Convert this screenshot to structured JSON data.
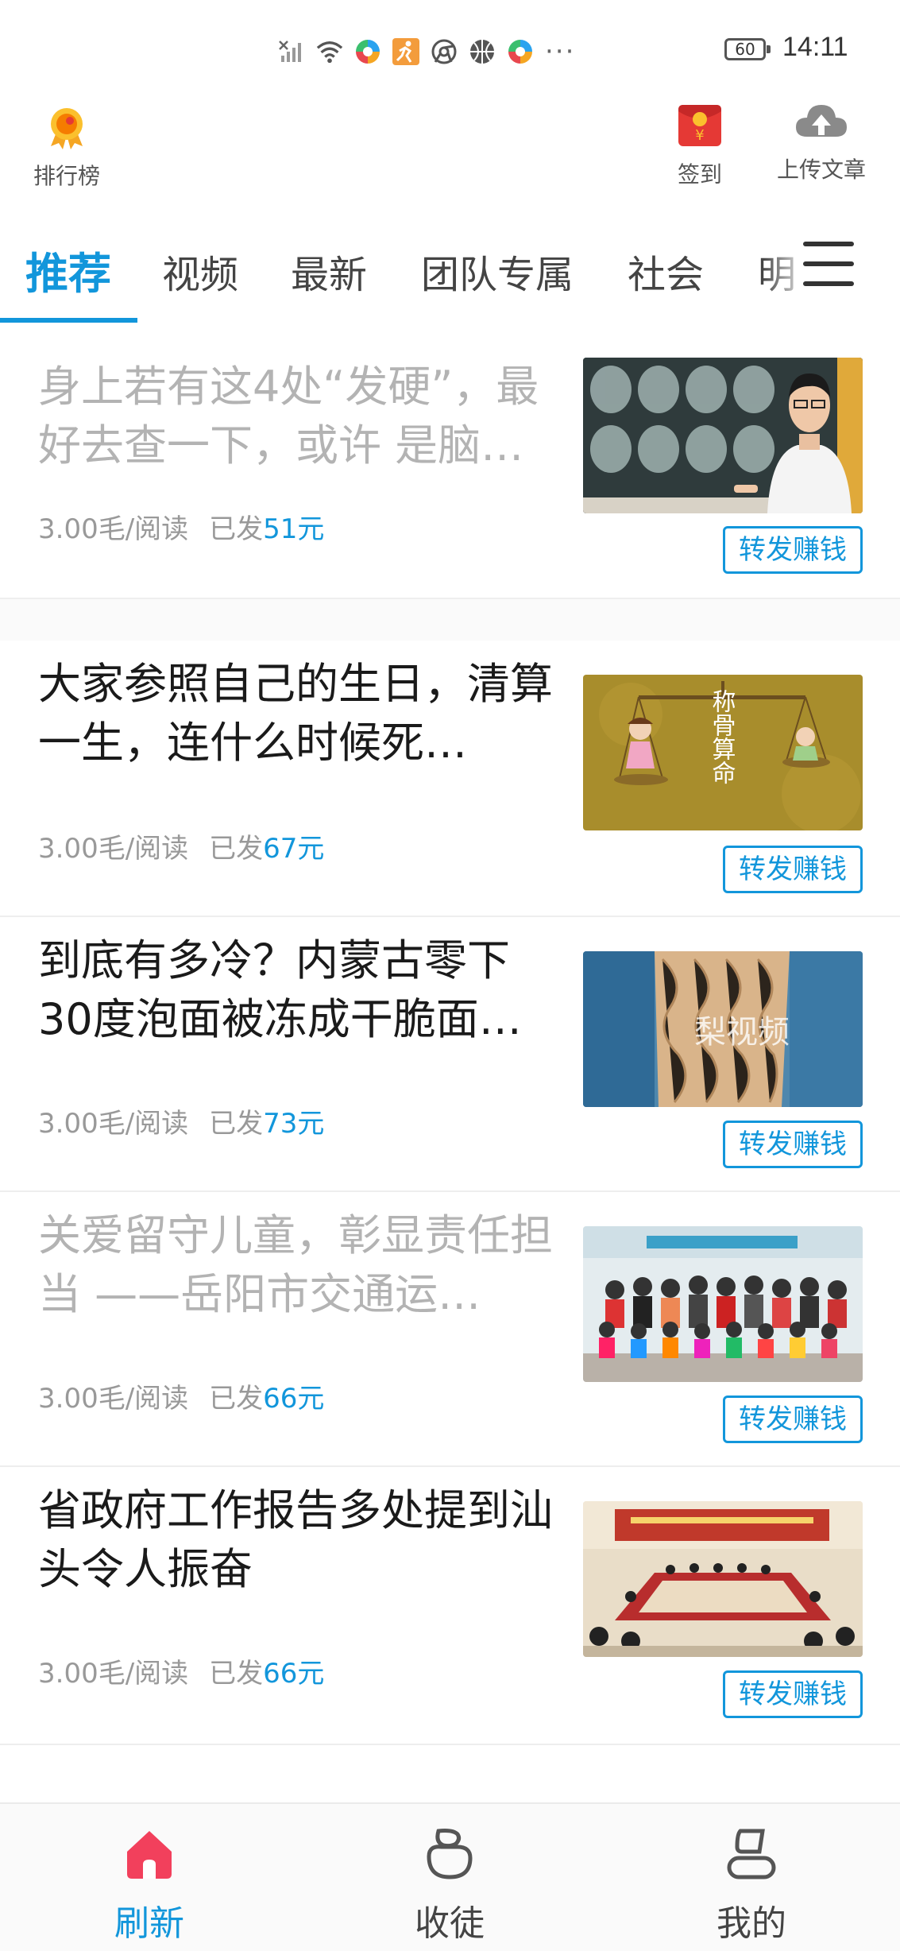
{
  "status_bar": {
    "time": "14:11",
    "battery": "60",
    "icons": [
      "no-sim-icon",
      "wifi-icon",
      "app-notification-icon",
      "fitness-icon",
      "chrome-icon",
      "basketball-icon",
      "app-notification-icon"
    ],
    "more": "···"
  },
  "header": {
    "rank_label": "排行榜",
    "signin_label": "签到",
    "upload_label": "上传文章"
  },
  "tabs": [
    {
      "label": "推荐",
      "active": true
    },
    {
      "label": "视频"
    },
    {
      "label": "最新"
    },
    {
      "label": "团队专属"
    },
    {
      "label": "社会"
    },
    {
      "label": "明"
    }
  ],
  "articles": [
    {
      "title": "身上若有这4处“发硬”，最好去查一下，或许 是脑…",
      "price": "3.00毛/阅读",
      "sent_prefix": "已发",
      "amount": "51元",
      "button": "转发赚钱",
      "read": true,
      "thumb": "brain-scan-doctor"
    },
    {
      "title": "大家参照自己的生日，清算一生，连什么时候死…",
      "price": "3.00毛/阅读",
      "sent_prefix": "已发",
      "amount": "67元",
      "button": "转发赚钱",
      "read": false,
      "thumb": "scale-fortune",
      "thumb_text": "称骨算命"
    },
    {
      "title": "到底有多冷？内蒙古零下30度泡面被冻成干脆面…",
      "price": "3.00毛/阅读",
      "sent_prefix": "已发",
      "amount": "73元",
      "button": "转发赚钱",
      "read": false,
      "thumb": "frozen-noodles",
      "thumb_text": "梨视频"
    },
    {
      "title": "关爱留守儿童，彰显责任担当 ——岳阳市交通运…",
      "price": "3.00毛/阅读",
      "sent_prefix": "已发",
      "amount": "66元",
      "button": "转发赚钱",
      "read": true,
      "thumb": "group-photo"
    },
    {
      "title": "省政府工作报告多处提到汕头令人振奋",
      "price": "3.00毛/阅读",
      "sent_prefix": "已发",
      "amount": "66元",
      "button": "转发赚钱",
      "read": false,
      "thumb": "meeting-room"
    }
  ],
  "bottom_nav": [
    {
      "label": "刷新",
      "icon": "home-icon",
      "active": true
    },
    {
      "label": "收徒",
      "icon": "apprentice-icon"
    },
    {
      "label": "我的",
      "icon": "profile-icon"
    }
  ],
  "colors": {
    "accent": "#1296db",
    "read_title": "#b3b3b3",
    "home_active": "#f2405c"
  }
}
